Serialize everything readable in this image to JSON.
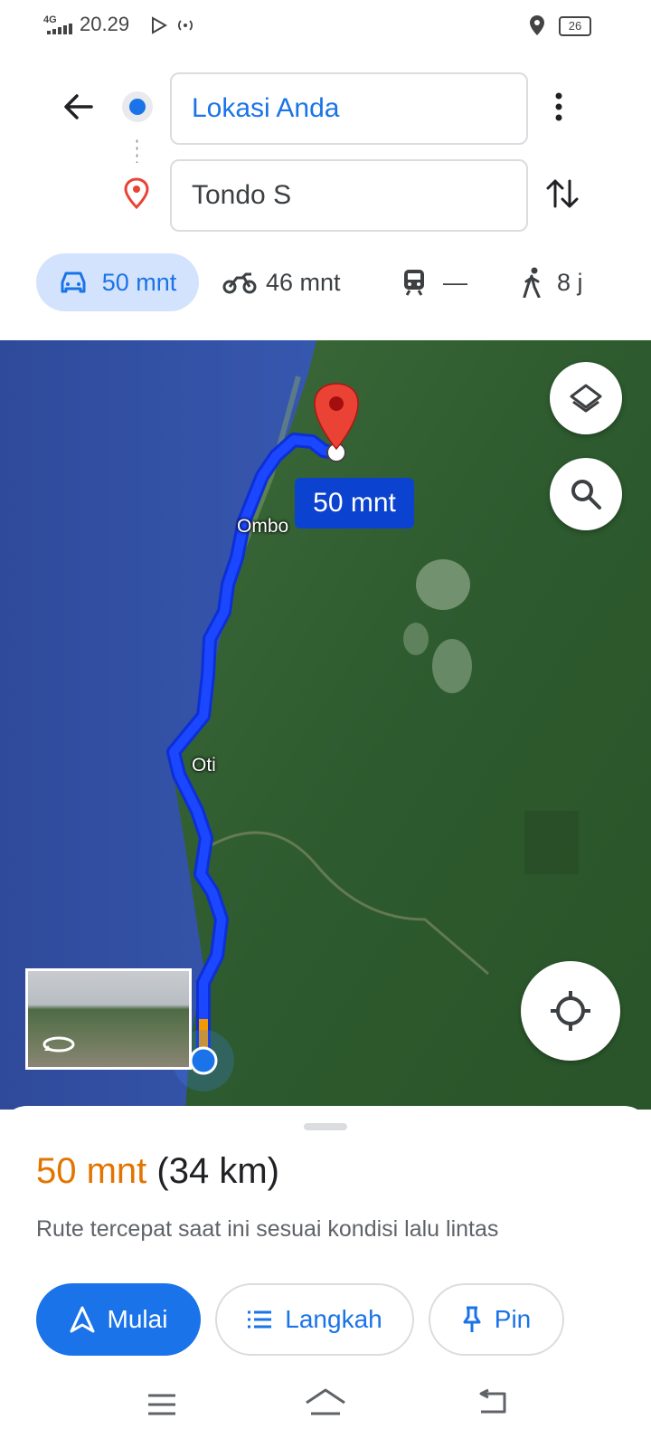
{
  "status_bar": {
    "network": "4G",
    "time": "20.29",
    "battery": "26"
  },
  "directions": {
    "origin": "Lokasi Anda",
    "destination": "Tondo S"
  },
  "modes": [
    {
      "icon": "car-icon",
      "label": "50 mnt",
      "selected": true
    },
    {
      "icon": "motorcycle-icon",
      "label": "46 mnt",
      "selected": false
    },
    {
      "icon": "train-icon",
      "label": "—",
      "selected": false
    },
    {
      "icon": "walk-icon",
      "label": "8 j",
      "selected": false
    }
  ],
  "map": {
    "eta_label": "50 mnt",
    "places": [
      "Ombo",
      "Oti"
    ],
    "route_color": "#1a47ff"
  },
  "route": {
    "duration": "50 mnt",
    "distance": "(34 km)",
    "description": "Rute tercepat saat ini sesuai kondisi lalu lintas"
  },
  "actions": {
    "start": "Mulai",
    "steps": "Langkah",
    "pin": "Pin"
  },
  "colors": {
    "accent": "#1a73e8",
    "duration": "#e37400",
    "destination_pin": "#ea4335"
  }
}
